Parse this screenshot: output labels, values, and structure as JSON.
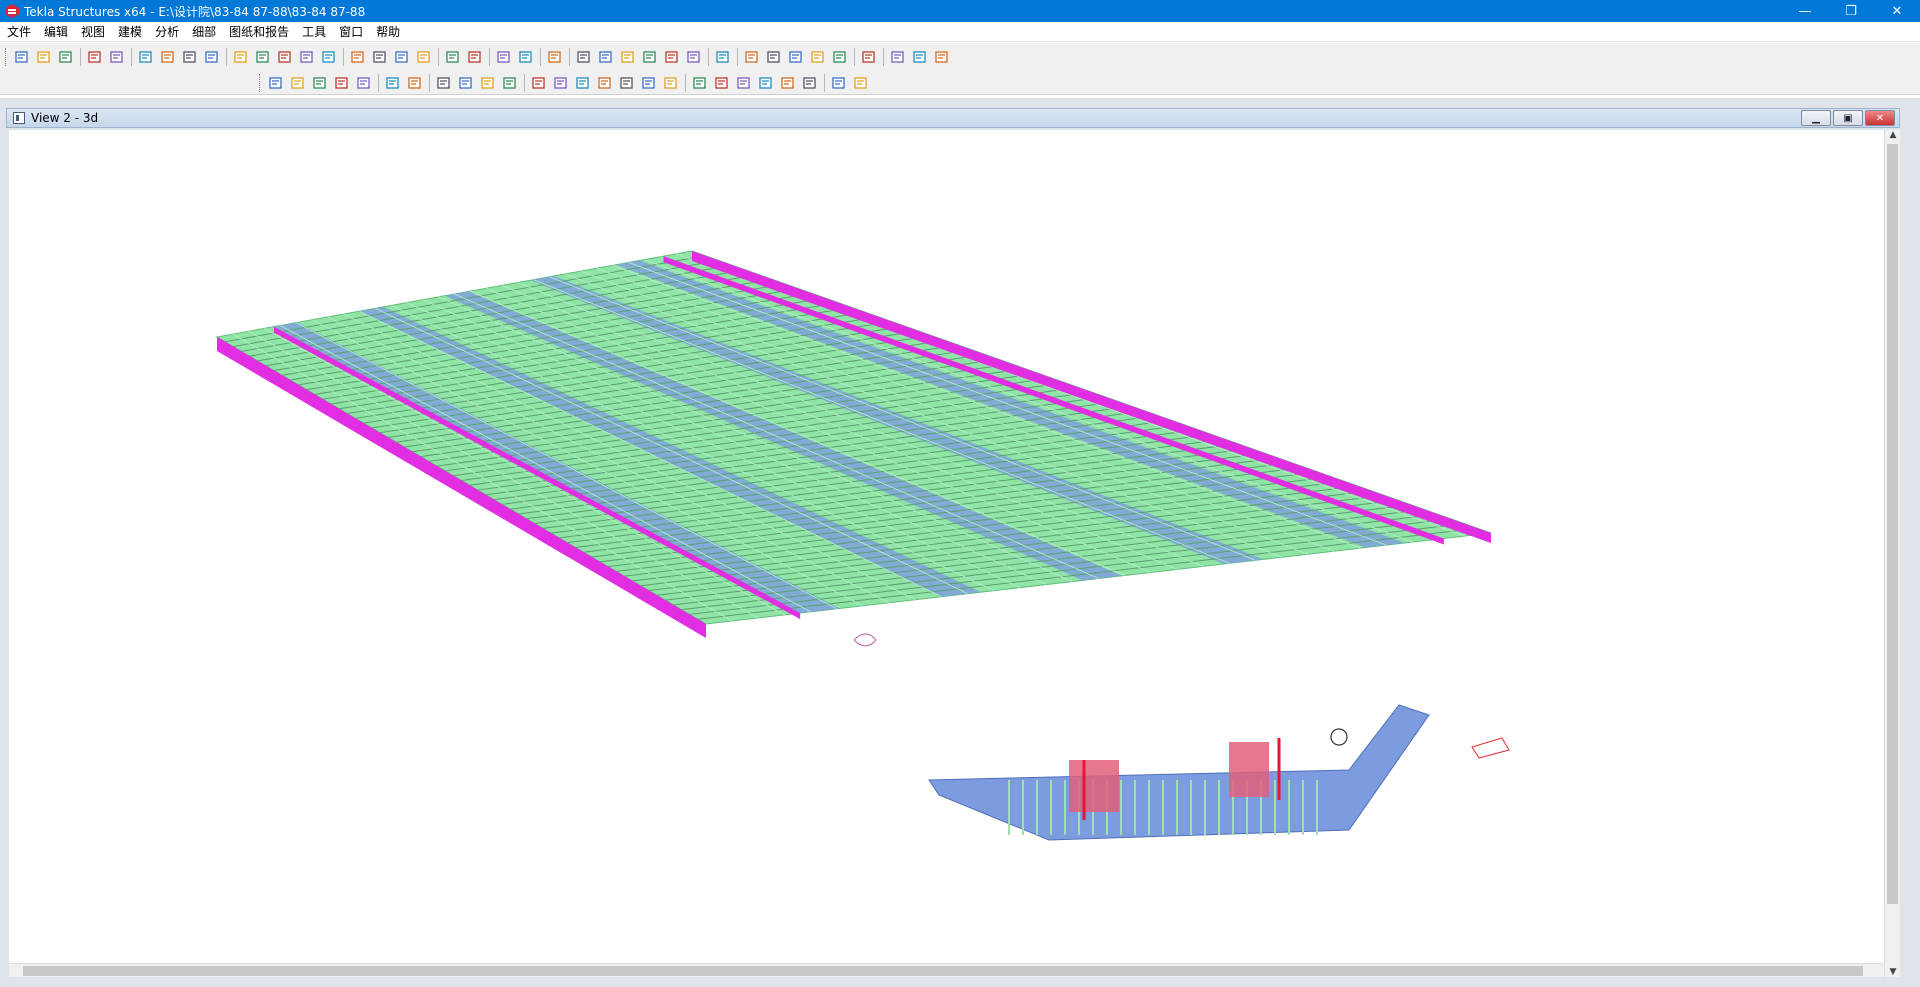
{
  "window": {
    "title": "Tekla Structures x64 - E:\\设计院\\83-84 87-88\\83-84 87-88",
    "minimize": "—",
    "restore": "❐",
    "close": "✕"
  },
  "menu": [
    "文件",
    "编辑",
    "视图",
    "建模",
    "分析",
    "细部",
    "图纸和报告",
    "工具",
    "窗口",
    "帮助"
  ],
  "toolbar": {
    "row1": [
      "new",
      "open",
      "save",
      "sep",
      "undo",
      "redo",
      "sep",
      "copy",
      "move",
      "paste",
      "numbering",
      "sep",
      "view",
      "window",
      "views",
      "cut",
      "select",
      "sep",
      "drawing",
      "drawing-list",
      "reports",
      "catalog",
      "sep",
      "snap",
      "snap2",
      "sep",
      "inquire",
      "info",
      "sep",
      "help-pointer",
      "sep",
      "grid",
      "grid2",
      "dim",
      "angle",
      "arc",
      "snapshot",
      "sep",
      "magic",
      "sep",
      "sel1",
      "sel2",
      "sel3",
      "sel4",
      "sel5",
      "sep",
      "tekla",
      "sep",
      "more",
      "more2",
      "more3"
    ],
    "row2": [
      "column",
      "beam",
      "poly-beam",
      "curved-beam",
      "plate-beam",
      "sep",
      "rebar",
      "anchor",
      "sep",
      "binoculars",
      "assembly",
      "grid-line",
      "plate",
      "sep",
      "bolt",
      "weld",
      "part",
      "comp1",
      "comp2",
      "comp3",
      "comp4",
      "sep",
      "line",
      "line2",
      "line3",
      "line4",
      "line5",
      "line6",
      "sep",
      "measure",
      "circle"
    ]
  },
  "view": {
    "title": "View 2 - 3d",
    "minimize": "▁",
    "restore": "▣",
    "close": "✕"
  },
  "colors": {
    "titlebar": "#0078d7",
    "deck_green": "#8fe4a6",
    "girder_blue": "#7d9ce0",
    "edge_magenta": "#e22ee2",
    "diaphragm_red": "#e0607a"
  }
}
